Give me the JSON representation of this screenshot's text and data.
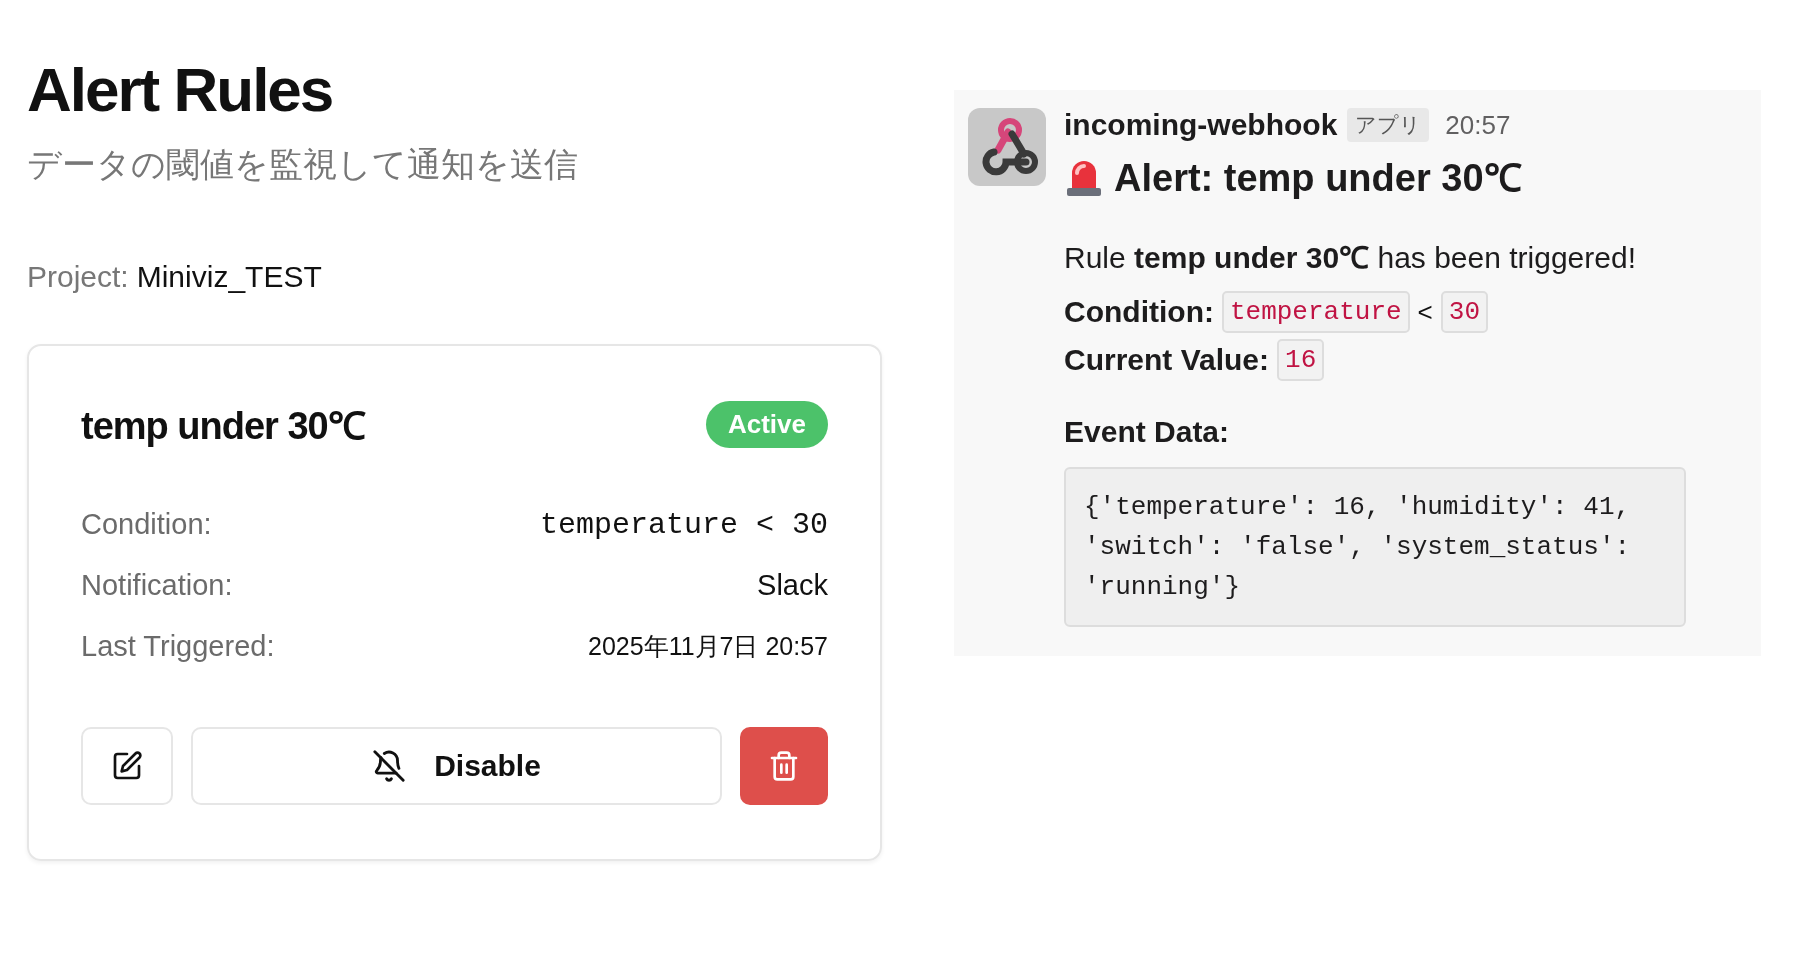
{
  "header": {
    "title": "Alert Rules",
    "subtitle": "データの閾値を監視して通知を送信"
  },
  "project": {
    "label": "Project:",
    "name": "Miniviz_TEST"
  },
  "rule": {
    "name": "temp under 30℃",
    "status": {
      "label": "Active",
      "active": true
    },
    "details": [
      {
        "kind": "code",
        "label": "Condition:",
        "value": "temperature < 30"
      },
      {
        "kind": "text",
        "label": "Notification:",
        "value": "Slack"
      },
      {
        "kind": "small",
        "label": "Last Triggered:",
        "value": "2025年11月7日 20:57"
      }
    ],
    "disable_button": "Disable"
  },
  "message": {
    "sender": "incoming-webhook",
    "app_badge": "アプリ",
    "time": "20:57",
    "heading": "Alert: temp under 30℃",
    "body": "Rule **temp under 30℃** has been triggered!",
    "condition": {
      "label": "Condition:",
      "field": "temperature",
      "operator": "<",
      "value": "30"
    },
    "current": {
      "label": "Current Value:",
      "value": "16"
    },
    "event_label": "Event Data:",
    "event_data": "{'temperature': 16, 'humidity': 41, 'switch': 'false', 'system_status': 'running'}"
  }
}
